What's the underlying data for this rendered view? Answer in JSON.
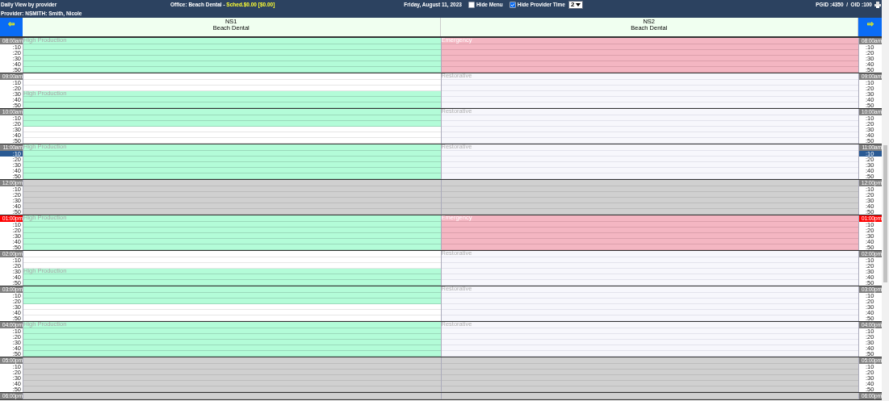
{
  "header": {
    "title": "Daily View by provider",
    "office": "Office: Beach Dental - ",
    "sched": "Sched.$0.00 [$0.00]",
    "date": "Friday, August 11, 2023",
    "hide_menu": {
      "label": "Hide Menu",
      "checked": false
    },
    "hide_provider_time": {
      "label": "Hide Provider Time",
      "checked": true
    },
    "select": {
      "value": "2"
    },
    "ids": "PGID :4350  /  OID :100",
    "provider": "Provider: NSMITH: Smith, Nicole"
  },
  "nav": {
    "prev": "⇦",
    "next": "⇨"
  },
  "columns": [
    {
      "code": "NS1",
      "office": "Beach Dental"
    },
    {
      "code": "NS2",
      "office": "Beach Dental"
    }
  ],
  "hours": [
    {
      "left": {
        "label": "08:00am",
        "current": false,
        "minutes": [
          {
            "text": ":10",
            "current": false
          },
          {
            "text": ":20",
            "current": false
          },
          {
            "text": ":30",
            "current": false
          },
          {
            "text": ":40",
            "current": false
          },
          {
            "text": ":50",
            "current": false
          }
        ]
      },
      "right": {
        "label": "08:00am",
        "current": false,
        "minutes": [
          {
            "text": ":10",
            "current": false
          },
          {
            "text": ":20",
            "current": false
          },
          {
            "text": ":30",
            "current": false
          },
          {
            "text": ":40",
            "current": false
          },
          {
            "text": ":50",
            "current": false
          }
        ]
      },
      "cells": [
        [
          {
            "kind": "production",
            "label": "High Production"
          },
          {
            "kind": "production"
          },
          {
            "kind": "production"
          },
          {
            "kind": "production"
          },
          {
            "kind": "production"
          },
          {
            "kind": "production"
          }
        ],
        [
          {
            "kind": "emergency",
            "label": "Emergency"
          },
          {
            "kind": "emergency"
          },
          {
            "kind": "emergency"
          },
          {
            "kind": "emergency"
          },
          {
            "kind": "emergency"
          },
          {
            "kind": "emergency"
          }
        ]
      ]
    },
    {
      "left": {
        "label": "09:00am",
        "current": false,
        "minutes": [
          {
            "text": ":10",
            "current": false
          },
          {
            "text": ":20",
            "current": false
          },
          {
            "text": ":30",
            "current": false
          },
          {
            "text": ":40",
            "current": false
          },
          {
            "text": ":50",
            "current": false
          }
        ]
      },
      "right": {
        "label": "09:00am",
        "current": false,
        "minutes": [
          {
            "text": ":10",
            "current": false
          },
          {
            "text": ":20",
            "current": false
          },
          {
            "text": ":30",
            "current": false
          },
          {
            "text": ":40",
            "current": false
          },
          {
            "text": ":50",
            "current": false
          }
        ]
      },
      "cells": [
        [
          {
            "kind": "open"
          },
          {
            "kind": "open"
          },
          {
            "kind": "open"
          },
          {
            "kind": "production",
            "label": "High Production"
          },
          {
            "kind": "production"
          },
          {
            "kind": "production"
          }
        ],
        [
          {
            "kind": "restorative",
            "label": "Restorative"
          },
          {
            "kind": "restorative"
          },
          {
            "kind": "restorative"
          },
          {
            "kind": "restorative"
          },
          {
            "kind": "restorative"
          },
          {
            "kind": "restorative"
          }
        ]
      ]
    },
    {
      "left": {
        "label": "10:00am",
        "current": false,
        "minutes": [
          {
            "text": ":10",
            "current": false
          },
          {
            "text": ":20",
            "current": false
          },
          {
            "text": ":30",
            "current": false
          },
          {
            "text": ":40",
            "current": false
          },
          {
            "text": ":50",
            "current": false
          }
        ]
      },
      "right": {
        "label": "10:00am",
        "current": false,
        "minutes": [
          {
            "text": ":10",
            "current": false
          },
          {
            "text": ":20",
            "current": false
          },
          {
            "text": ":30",
            "current": false
          },
          {
            "text": ":40",
            "current": false
          },
          {
            "text": ":50",
            "current": false
          }
        ]
      },
      "cells": [
        [
          {
            "kind": "production"
          },
          {
            "kind": "production"
          },
          {
            "kind": "production"
          },
          {
            "kind": "open"
          },
          {
            "kind": "open"
          },
          {
            "kind": "open"
          }
        ],
        [
          {
            "kind": "restorative",
            "label": "Restorative"
          },
          {
            "kind": "restorative"
          },
          {
            "kind": "restorative"
          },
          {
            "kind": "restorative"
          },
          {
            "kind": "restorative"
          },
          {
            "kind": "restorative"
          }
        ]
      ]
    },
    {
      "left": {
        "label": "11:00am",
        "current": false,
        "minutes": [
          {
            "text": ":10",
            "current": true
          },
          {
            "text": ":20",
            "current": false
          },
          {
            "text": ":30",
            "current": false
          },
          {
            "text": ":40",
            "current": false
          },
          {
            "text": ":50",
            "current": false
          }
        ]
      },
      "right": {
        "label": "11:00am",
        "current": false,
        "minutes": [
          {
            "text": ":10",
            "current": true
          },
          {
            "text": ":20",
            "current": false
          },
          {
            "text": ":30",
            "current": false
          },
          {
            "text": ":40",
            "current": false
          },
          {
            "text": ":50",
            "current": false
          }
        ]
      },
      "cells": [
        [
          {
            "kind": "production",
            "label": "High Production"
          },
          {
            "kind": "production"
          },
          {
            "kind": "production"
          },
          {
            "kind": "production"
          },
          {
            "kind": "production"
          },
          {
            "kind": "production"
          }
        ],
        [
          {
            "kind": "restorative",
            "label": "Restorative"
          },
          {
            "kind": "restorative"
          },
          {
            "kind": "restorative"
          },
          {
            "kind": "restorative"
          },
          {
            "kind": "restorative"
          },
          {
            "kind": "restorative"
          }
        ]
      ]
    },
    {
      "left": {
        "label": "12:00pm",
        "current": false,
        "minutes": [
          {
            "text": ":10",
            "current": false
          },
          {
            "text": ":20",
            "current": false
          },
          {
            "text": ":30",
            "current": false
          },
          {
            "text": ":40",
            "current": false
          },
          {
            "text": ":50",
            "current": false
          }
        ]
      },
      "right": {
        "label": "12:00pm",
        "current": false,
        "minutes": [
          {
            "text": ":10",
            "current": false
          },
          {
            "text": ":20",
            "current": false
          },
          {
            "text": ":30",
            "current": false
          },
          {
            "text": ":40",
            "current": false
          },
          {
            "text": ":50",
            "current": false
          }
        ]
      },
      "cells": [
        [
          {
            "kind": "blocked"
          },
          {
            "kind": "blocked"
          },
          {
            "kind": "blocked"
          },
          {
            "kind": "blocked"
          },
          {
            "kind": "blocked"
          },
          {
            "kind": "blocked"
          }
        ],
        [
          {
            "kind": "blocked"
          },
          {
            "kind": "blocked"
          },
          {
            "kind": "blocked"
          },
          {
            "kind": "blocked"
          },
          {
            "kind": "blocked"
          },
          {
            "kind": "blocked"
          }
        ]
      ]
    },
    {
      "left": {
        "label": "01:00pm",
        "current": true,
        "minutes": [
          {
            "text": ":10",
            "current": false
          },
          {
            "text": ":20",
            "current": false
          },
          {
            "text": ":30",
            "current": false
          },
          {
            "text": ":40",
            "current": false
          },
          {
            "text": ":50",
            "current": false
          }
        ]
      },
      "right": {
        "label": "01:00pm",
        "current": true,
        "minutes": [
          {
            "text": ":10",
            "current": false
          },
          {
            "text": ":20",
            "current": false
          },
          {
            "text": ":30",
            "current": false
          },
          {
            "text": ":40",
            "current": false
          },
          {
            "text": ":50",
            "current": false
          }
        ]
      },
      "cells": [
        [
          {
            "kind": "production",
            "label": "High Production"
          },
          {
            "kind": "production"
          },
          {
            "kind": "production"
          },
          {
            "kind": "production"
          },
          {
            "kind": "production"
          },
          {
            "kind": "production"
          }
        ],
        [
          {
            "kind": "emergency",
            "label": "Emergency"
          },
          {
            "kind": "emergency"
          },
          {
            "kind": "emergency"
          },
          {
            "kind": "emergency"
          },
          {
            "kind": "emergency"
          },
          {
            "kind": "emergency"
          }
        ]
      ]
    },
    {
      "left": {
        "label": "02:00pm",
        "current": false,
        "minutes": [
          {
            "text": ":10",
            "current": false
          },
          {
            "text": ":20",
            "current": false
          },
          {
            "text": ":30",
            "current": false
          },
          {
            "text": ":40",
            "current": false
          },
          {
            "text": ":50",
            "current": false
          }
        ]
      },
      "right": {
        "label": "02:00pm",
        "current": false,
        "minutes": [
          {
            "text": ":10",
            "current": false
          },
          {
            "text": ":20",
            "current": false
          },
          {
            "text": ":30",
            "current": false
          },
          {
            "text": ":40",
            "current": false
          },
          {
            "text": ":50",
            "current": false
          }
        ]
      },
      "cells": [
        [
          {
            "kind": "open"
          },
          {
            "kind": "open"
          },
          {
            "kind": "open"
          },
          {
            "kind": "production",
            "label": "High Production"
          },
          {
            "kind": "production"
          },
          {
            "kind": "production"
          }
        ],
        [
          {
            "kind": "restorative",
            "label": "Restorative"
          },
          {
            "kind": "restorative"
          },
          {
            "kind": "restorative"
          },
          {
            "kind": "restorative"
          },
          {
            "kind": "restorative"
          },
          {
            "kind": "restorative"
          }
        ]
      ]
    },
    {
      "left": {
        "label": "03:00pm",
        "current": false,
        "minutes": [
          {
            "text": ":10",
            "current": false
          },
          {
            "text": ":20",
            "current": false
          },
          {
            "text": ":30",
            "current": false
          },
          {
            "text": ":40",
            "current": false
          },
          {
            "text": ":50",
            "current": false
          }
        ]
      },
      "right": {
        "label": "03:00pm",
        "current": false,
        "minutes": [
          {
            "text": ":10",
            "current": false
          },
          {
            "text": ":20",
            "current": false
          },
          {
            "text": ":30",
            "current": false
          },
          {
            "text": ":40",
            "current": false
          },
          {
            "text": ":50",
            "current": false
          }
        ]
      },
      "cells": [
        [
          {
            "kind": "production"
          },
          {
            "kind": "production"
          },
          {
            "kind": "production"
          },
          {
            "kind": "open"
          },
          {
            "kind": "open"
          },
          {
            "kind": "open"
          }
        ],
        [
          {
            "kind": "restorative",
            "label": "Restorative"
          },
          {
            "kind": "restorative"
          },
          {
            "kind": "restorative"
          },
          {
            "kind": "restorative"
          },
          {
            "kind": "restorative"
          },
          {
            "kind": "restorative"
          }
        ]
      ]
    },
    {
      "left": {
        "label": "04:00pm",
        "current": false,
        "minutes": [
          {
            "text": ":10",
            "current": false
          },
          {
            "text": ":20",
            "current": false
          },
          {
            "text": ":30",
            "current": false
          },
          {
            "text": ":40",
            "current": false
          },
          {
            "text": ":50",
            "current": false
          }
        ]
      },
      "right": {
        "label": "04:00pm",
        "current": false,
        "minutes": [
          {
            "text": ":10",
            "current": false
          },
          {
            "text": ":20",
            "current": false
          },
          {
            "text": ":30",
            "current": false
          },
          {
            "text": ":40",
            "current": false
          },
          {
            "text": ":50",
            "current": false
          }
        ]
      },
      "cells": [
        [
          {
            "kind": "production",
            "label": "High Production"
          },
          {
            "kind": "production"
          },
          {
            "kind": "production"
          },
          {
            "kind": "production"
          },
          {
            "kind": "production"
          },
          {
            "kind": "production"
          }
        ],
        [
          {
            "kind": "restorative",
            "label": "Restorative"
          },
          {
            "kind": "restorative"
          },
          {
            "kind": "restorative"
          },
          {
            "kind": "restorative"
          },
          {
            "kind": "restorative"
          },
          {
            "kind": "restorative"
          }
        ]
      ]
    },
    {
      "left": {
        "label": "05:00pm",
        "current": false,
        "minutes": [
          {
            "text": ":10",
            "current": false
          },
          {
            "text": ":20",
            "current": false
          },
          {
            "text": ":30",
            "current": false
          },
          {
            "text": ":40",
            "current": false
          },
          {
            "text": ":50",
            "current": false
          }
        ]
      },
      "right": {
        "label": "05:00pm",
        "current": false,
        "minutes": [
          {
            "text": ":10",
            "current": false
          },
          {
            "text": ":20",
            "current": false
          },
          {
            "text": ":30",
            "current": false
          },
          {
            "text": ":40",
            "current": false
          },
          {
            "text": ":50",
            "current": false
          }
        ]
      },
      "cells": [
        [
          {
            "kind": "blocked"
          },
          {
            "kind": "blocked"
          },
          {
            "kind": "blocked"
          },
          {
            "kind": "blocked"
          },
          {
            "kind": "blocked"
          },
          {
            "kind": "blocked"
          }
        ],
        [
          {
            "kind": "blocked"
          },
          {
            "kind": "blocked"
          },
          {
            "kind": "blocked"
          },
          {
            "kind": "blocked"
          },
          {
            "kind": "blocked"
          },
          {
            "kind": "blocked"
          }
        ]
      ]
    },
    {
      "left": {
        "label": "06:00pm",
        "current": false
      },
      "right": {
        "label": "06:00pm",
        "current": false
      },
      "cells": [
        [
          {
            "kind": "blocked"
          }
        ],
        [
          {
            "kind": "blocked"
          }
        ]
      ]
    }
  ]
}
